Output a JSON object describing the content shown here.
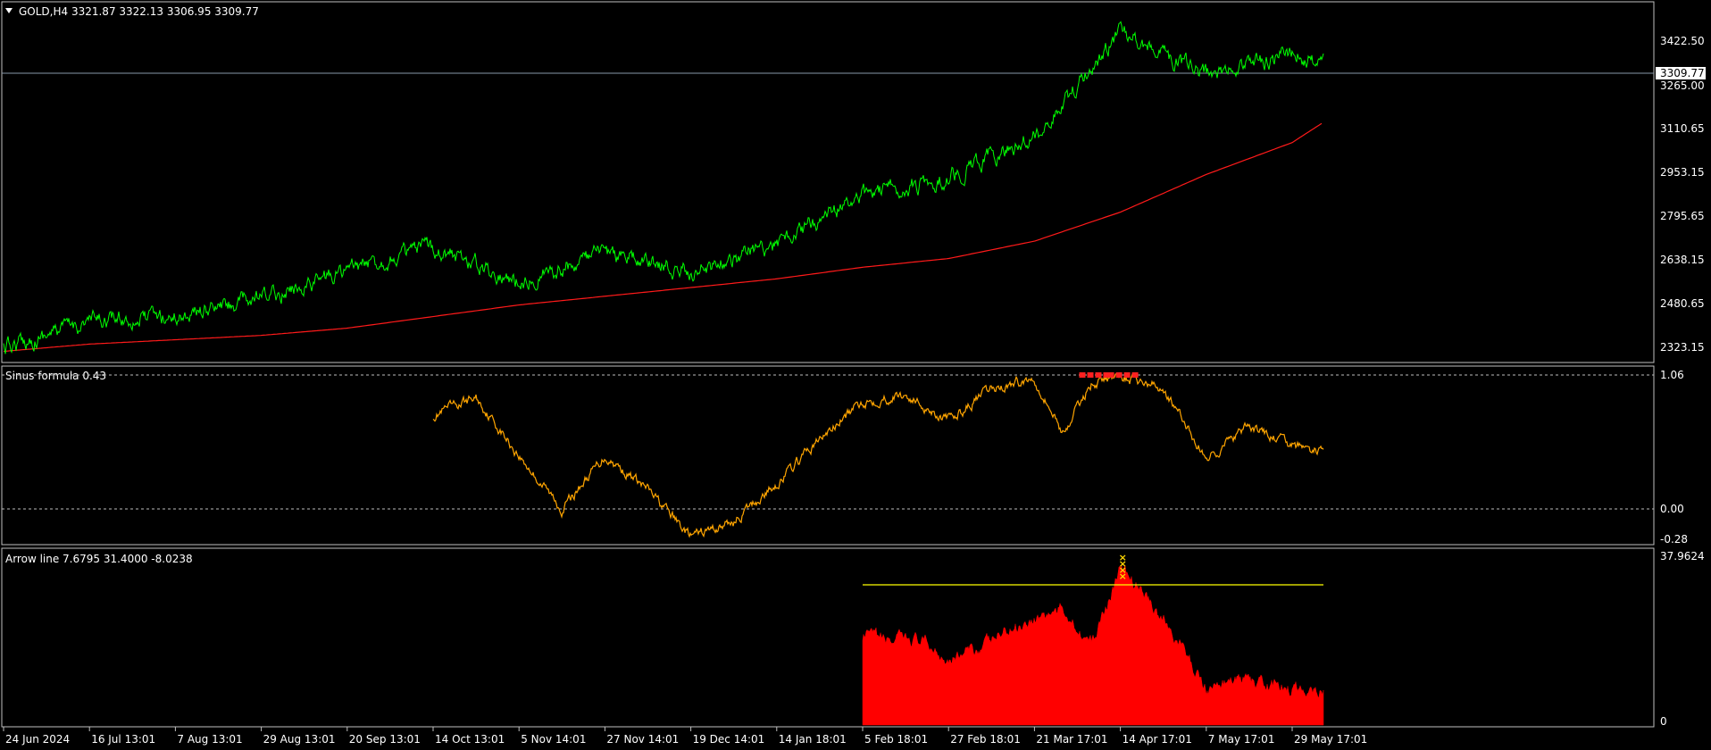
{
  "colors": {
    "background": "#000000",
    "frame": "#c0c0c0",
    "price_line": "#00ff00",
    "moving_average": "#ff1a1a",
    "oscillator": "#ffa500",
    "signal_marks": "#ff2020",
    "histogram": "#ff0000",
    "threshold_line": "#ffff00",
    "arrow_marks": "#ffd700",
    "current_price_box": "#ffffff"
  },
  "main_panel": {
    "header": "GOLD,H4  3321.87 3322.13 3306.95 3309.77",
    "current_price": "3309.77",
    "price_ticks": [
      "3422.50",
      "3265.00",
      "3110.65",
      "2953.15",
      "2795.65",
      "2638.15",
      "2480.65",
      "2323.15"
    ]
  },
  "osc_panel": {
    "header": "Sinus formula 0.43",
    "ticks": [
      "1.06",
      "0.00",
      "-0.28"
    ]
  },
  "hist_panel": {
    "header": "Arrow line 7.6795 31.4000 -8.0238",
    "ticks": [
      "37.9624",
      "0"
    ]
  },
  "time_axis": {
    "labels": [
      "24 Jun 2024",
      "16 Jul 13:01",
      "7 Aug 13:01",
      "29 Aug 13:01",
      "20 Sep 13:01",
      "14 Oct 13:01",
      "5 Nov 14:01",
      "27 Nov 14:01",
      "19 Dec 14:01",
      "14 Jan 18:01",
      "5 Feb 18:01",
      "27 Feb 18:01",
      "21 Mar 17:01",
      "14 Apr 17:01",
      "7 May 17:01",
      "29 May 17:01"
    ]
  },
  "chart_data": [
    {
      "type": "line",
      "ylim": [
        2300,
        3470
      ],
      "x": [
        "24 Jun 2024",
        "16 Jul 13:01",
        "7 Aug 13:01",
        "29 Aug 13:01",
        "20 Sep 13:01",
        "14 Oct 13:01",
        "5 Nov 14:01",
        "27 Nov 14:01",
        "19 Dec 14:01",
        "14 Jan 18:01",
        "5 Feb 18:01",
        "27 Feb 18:01",
        "21 Mar 17:01",
        "14 Apr 17:01",
        "7 May 17:01",
        "29 May 17:01",
        "6 Jun"
      ],
      "series": [
        {
          "values": [
            2330,
            2425,
            2440,
            2500,
            2600,
            2680,
            2560,
            2660,
            2590,
            2690,
            2860,
            2920,
            3060,
            3420,
            3270,
            3350,
            3310
          ]
        },
        {
          "values": [
            2320,
            2345,
            2360,
            2375,
            2400,
            2440,
            2480,
            2510,
            2540,
            2570,
            2610,
            2640,
            2700,
            2800,
            2930,
            3040,
            3110
          ]
        }
      ]
    },
    {
      "type": "line",
      "ylim": [
        -0.3,
        1.1
      ],
      "x": [
        "14 Oct 13:01",
        "24 Oct",
        "5 Nov 14:01",
        "14 Nov",
        "27 Nov 14:01",
        "10 Dec",
        "19 Dec 14:01",
        "2 Jan",
        "14 Jan 18:01",
        "25 Jan",
        "5 Feb 18:01",
        "15 Feb",
        "27 Feb 18:01",
        "10 Mar",
        "21 Mar 17:01",
        "28 Mar",
        "5 Apr",
        "14 Apr 17:01",
        "25 Apr",
        "7 May 17:01",
        "18 May",
        "29 May 17:01",
        "6 Jun"
      ],
      "series": [
        {
          "values": [
            0.74,
            0.88,
            0.42,
            0.0,
            0.42,
            0.15,
            -0.22,
            -0.1,
            0.2,
            0.55,
            0.85,
            0.9,
            0.7,
            0.95,
            1.03,
            0.6,
            1.0,
            1.05,
            0.95,
            0.4,
            0.65,
            0.5,
            0.45
          ]
        },
        {
          "values": [
            null,
            null,
            null,
            null,
            null,
            null,
            null,
            null,
            null,
            null,
            null,
            null,
            null,
            null,
            null,
            null,
            1.06,
            1.06,
            null,
            null,
            null,
            null,
            null
          ]
        }
      ]
    },
    {
      "type": "area",
      "ylim": [
        0,
        38
      ],
      "x": [
        "5 Feb 18:01",
        "12 Feb",
        "20 Feb",
        "27 Feb 18:01",
        "7 Mar",
        "14 Mar",
        "21 Mar 17:01",
        "28 Mar",
        "5 Apr",
        "14 Apr 17:01",
        "22 Apr",
        "1 May",
        "7 May 17:01",
        "14 May",
        "22 May",
        "29 May 17:01",
        "6 Jun"
      ],
      "series": [
        {
          "values": [
            20,
            19,
            19,
            15,
            17,
            21,
            24,
            26,
            18,
            35,
            28,
            19,
            8,
            10,
            9,
            8,
            8
          ]
        },
        {
          "values": [
            31.4,
            31.4,
            31.4,
            31.4,
            31.4,
            31.4,
            31.4,
            31.4,
            31.4,
            31.4,
            31.4,
            31.4,
            31.4,
            31.4,
            31.4,
            31.4,
            31.4
          ]
        }
      ]
    }
  ]
}
